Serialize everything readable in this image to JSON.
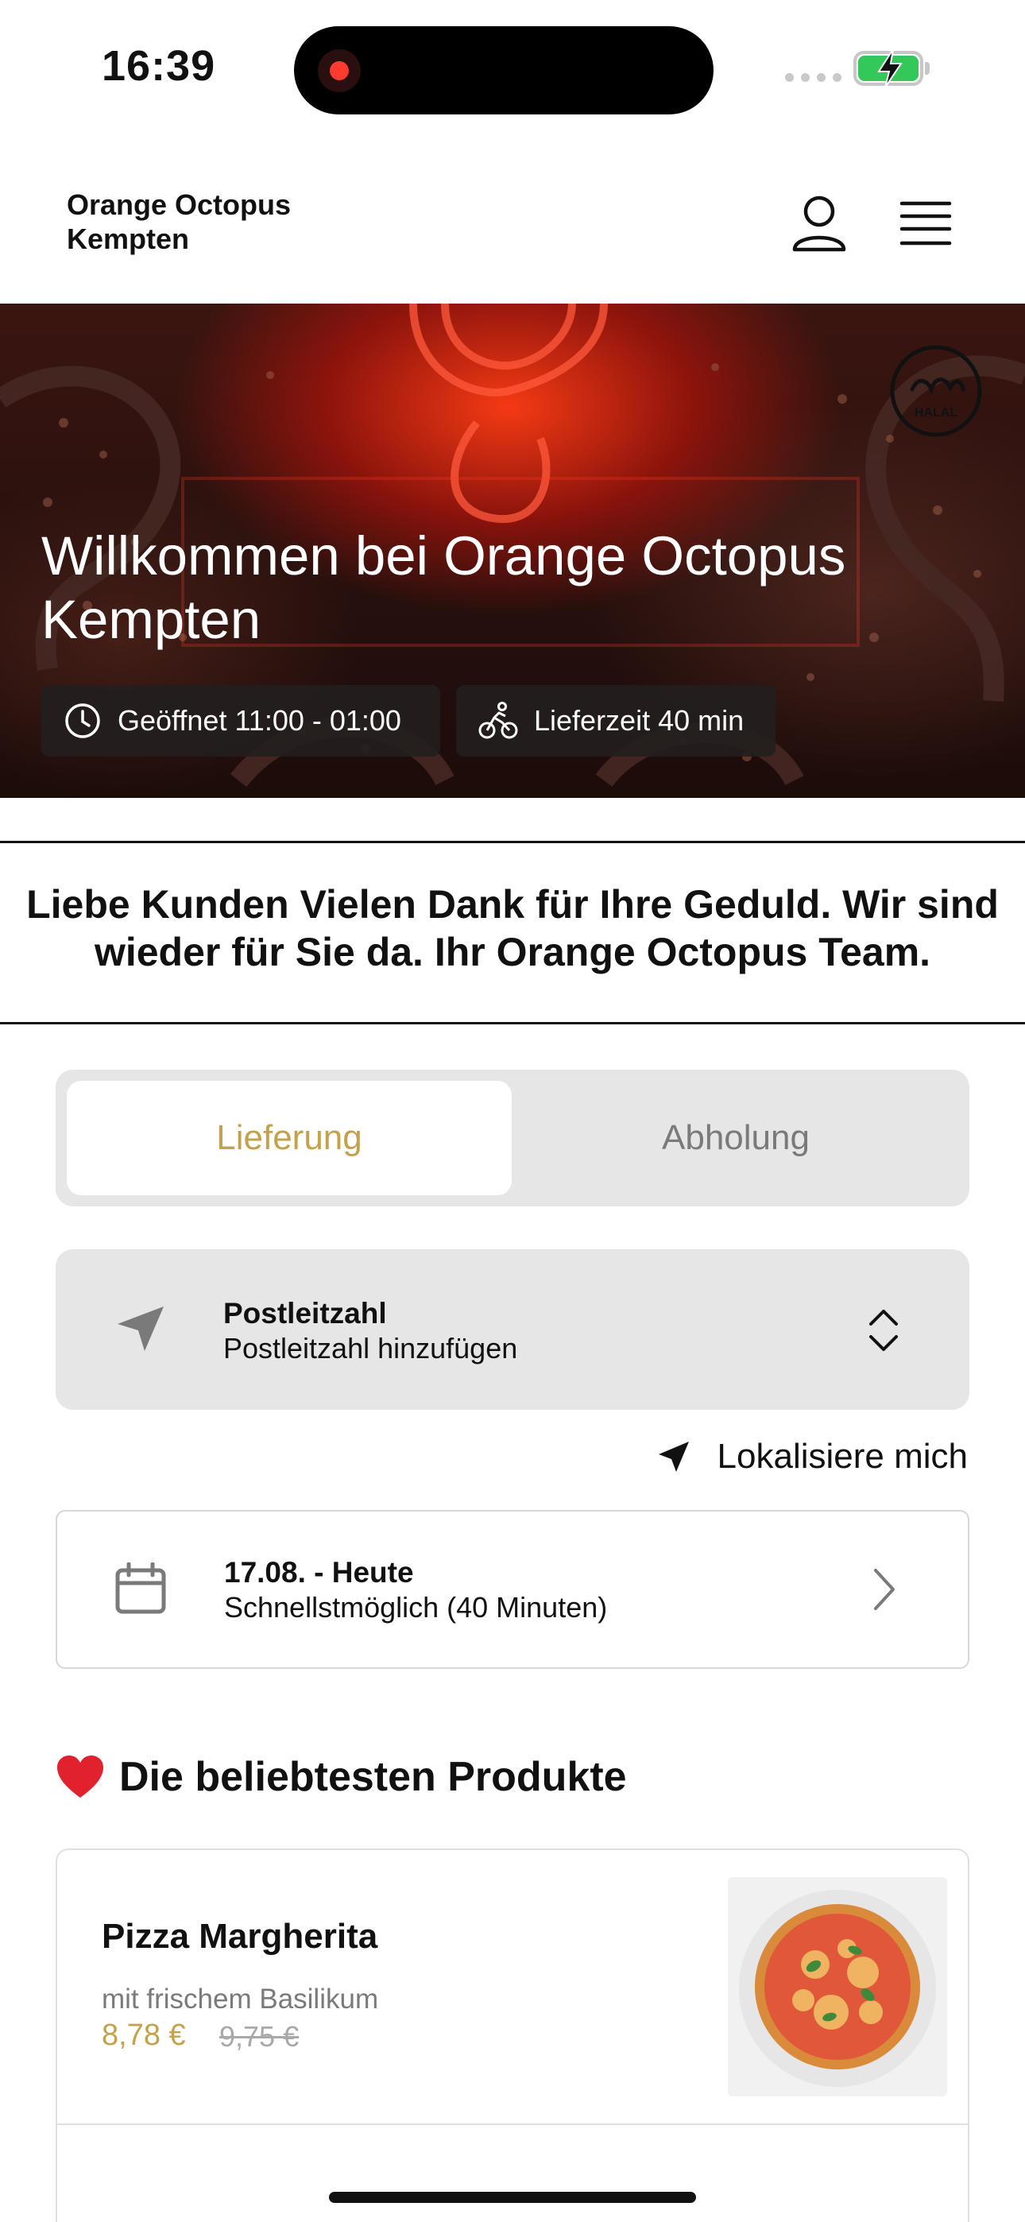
{
  "status_bar": {
    "time": "16:39"
  },
  "header": {
    "brand_line1": "Orange Octopus",
    "brand_line2": "Kempten"
  },
  "hero": {
    "title": "Willkommen bei Orange Octopus Kempten",
    "halal_label": "HALAL",
    "opening_hours": "Geöffnet 11:00 - 01:00",
    "delivery_time": "Lieferzeit 40 min"
  },
  "notice": {
    "text": "Liebe Kunden Vielen Dank für Ihre Geduld. Wir sind wieder für Sie da. Ihr Orange Octopus Team."
  },
  "order_mode": {
    "active": "Lieferung",
    "inactive": "Abholung"
  },
  "postcode": {
    "title": "Postleitzahl",
    "subtitle": "Postleitzahl hinzufügen"
  },
  "locate": {
    "label": "Lokalisiere mich"
  },
  "delivery_slot": {
    "date": "17.08. - Heute",
    "time": "Schnellstmöglich (40 Minuten)"
  },
  "popular": {
    "title": "Die beliebtesten Produkte",
    "products": [
      {
        "name": "Pizza Margherita",
        "description": "mit frischem Basilikum",
        "price": "8,78 €",
        "old_price": "9,75 €"
      }
    ]
  },
  "colors": {
    "accent": "#c2a24c",
    "battery": "#34c759"
  }
}
